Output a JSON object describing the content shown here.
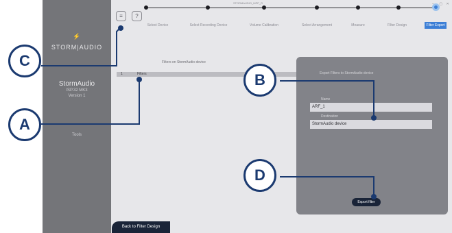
{
  "window": {
    "title": "STORMAUDIO_MPP_R",
    "controls": "— ▢ ✕"
  },
  "toolbar": {
    "menu_glyph": "≡",
    "help_label": "?"
  },
  "sidebar": {
    "logo_mark": "⚡",
    "logo_text": "STORM|AUDIO",
    "device_name": "StormAudio",
    "device_sub1": "ISP.32 MK3",
    "device_sub2": "Version 1",
    "menu_item": "Tools"
  },
  "steps": [
    {
      "label": "Select Device"
    },
    {
      "label": "Select Recording Device"
    },
    {
      "label": "Volume Calibration"
    },
    {
      "label": "Select Arrangement"
    },
    {
      "label": "Measure"
    },
    {
      "label": "Filter Design"
    },
    {
      "label": "Filter Export",
      "active": true
    }
  ],
  "filters": {
    "title": "Filters on StormAudio device",
    "rows": [
      {
        "index": "1",
        "name": "Filters"
      }
    ]
  },
  "export_panel": {
    "title": "Export Filters to StormAudio device",
    "name_label": "Name",
    "name_value": "ARF_1",
    "dest_label": "Destination",
    "dest_value": "StormAudio device",
    "export_button": "Export filter"
  },
  "back_button": "Back to Filter Design",
  "callouts": {
    "a": "A",
    "b": "B",
    "c": "C",
    "d": "D"
  },
  "colors": {
    "callout": "#1b3a70",
    "active_step": "#3d7fd6",
    "button_dark": "#1a2438",
    "sidebar": "#747579",
    "panel": "#828389"
  }
}
